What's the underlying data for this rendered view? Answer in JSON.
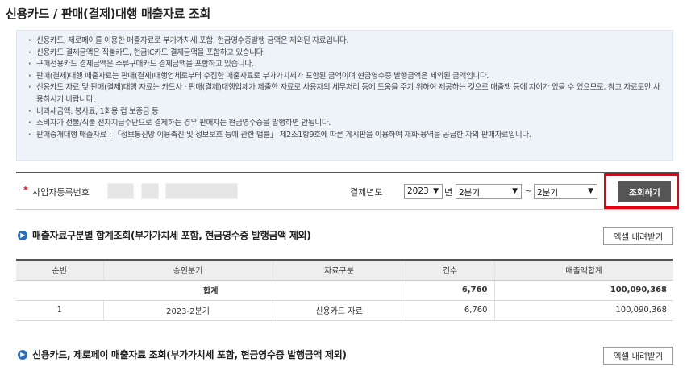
{
  "page_title": "신용카드 / 판매(결제)대행 매출자료 조회",
  "notice": [
    "신용카드, 제로페이를 이용한 매출자료로 부가가치세 포함, 현금영수증발행 금액은 제외된 자료입니다.",
    "신용카드 결제금액은 직불카드, 현금IC카드 결제금액을 포함하고 있습니다.",
    "구매전용카드 결제금액은 주류구매카드 결제금액을 포함하고 있습니다.",
    "판매(결제)대행 매출자료는 판매(결제)대행업체로부터 수집한 매출자료로 부가가치세가 포함된 금액이며 현금영수증 발행금액은 제외된 금액입니다.",
    "신용카드 자료 및 판매(결제)대행 자료는 카드사 · 판매(결제)대행업체가 제출한 자료로 사용자의 세무처리 등에 도움을 주기 위하여 제공하는 것으로 매출액 등에 차이가 있을 수 있으므로, 참고 자료로만 사용하시기 바랍니다.",
    "비과세금액: 봉사료, 1회용 컵 보증금 등",
    "소비자가 선불/직불 전자지급수단으로 결제하는 경우 판매자는 현금영수증을 발행하면 안됩니다.",
    "판매중개대행 매출자료 : 「정보통신망 이용촉진 및 정보보호 등에 관한 법률」 제2조1항9호에 따른 게시판을 이용하여 재화·용역을 공급한 자의 판매자료입니다."
  ],
  "search": {
    "required_mark": "*",
    "biz_no_label": "사업자등록번호",
    "year_label": "결제년도",
    "year_value": "2023",
    "year_unit": "년",
    "quarter_from": "2분기",
    "tilde": "~",
    "quarter_to": "2분기",
    "search_button": "조회하기"
  },
  "section1": {
    "title": "매출자료구분별 합계조회(부가가치세 포함, 현금영수증 발행금액 제외)",
    "excel_button": "엑셀 내려받기",
    "columns": [
      "순번",
      "승인분기",
      "자료구분",
      "건수",
      "매출액합계"
    ],
    "total_row": {
      "label": "합계",
      "count": "6,760",
      "amount": "100,090,368"
    },
    "rows": [
      {
        "no": "1",
        "quarter": "2023-2분기",
        "type": "신용카드 자료",
        "count": "6,760",
        "amount": "100,090,368"
      }
    ]
  },
  "section2": {
    "title": "신용카드, 제로페이 매출자료 조회(부가가치세 포함, 현금영수증 발행금액 제외)",
    "excel_button": "엑셀 내려받기"
  },
  "colors": {
    "highlight": "#e60012",
    "section_icon": "#2a6ebb",
    "notice_bg": "#eef3fa",
    "button_dark": "#555555"
  }
}
